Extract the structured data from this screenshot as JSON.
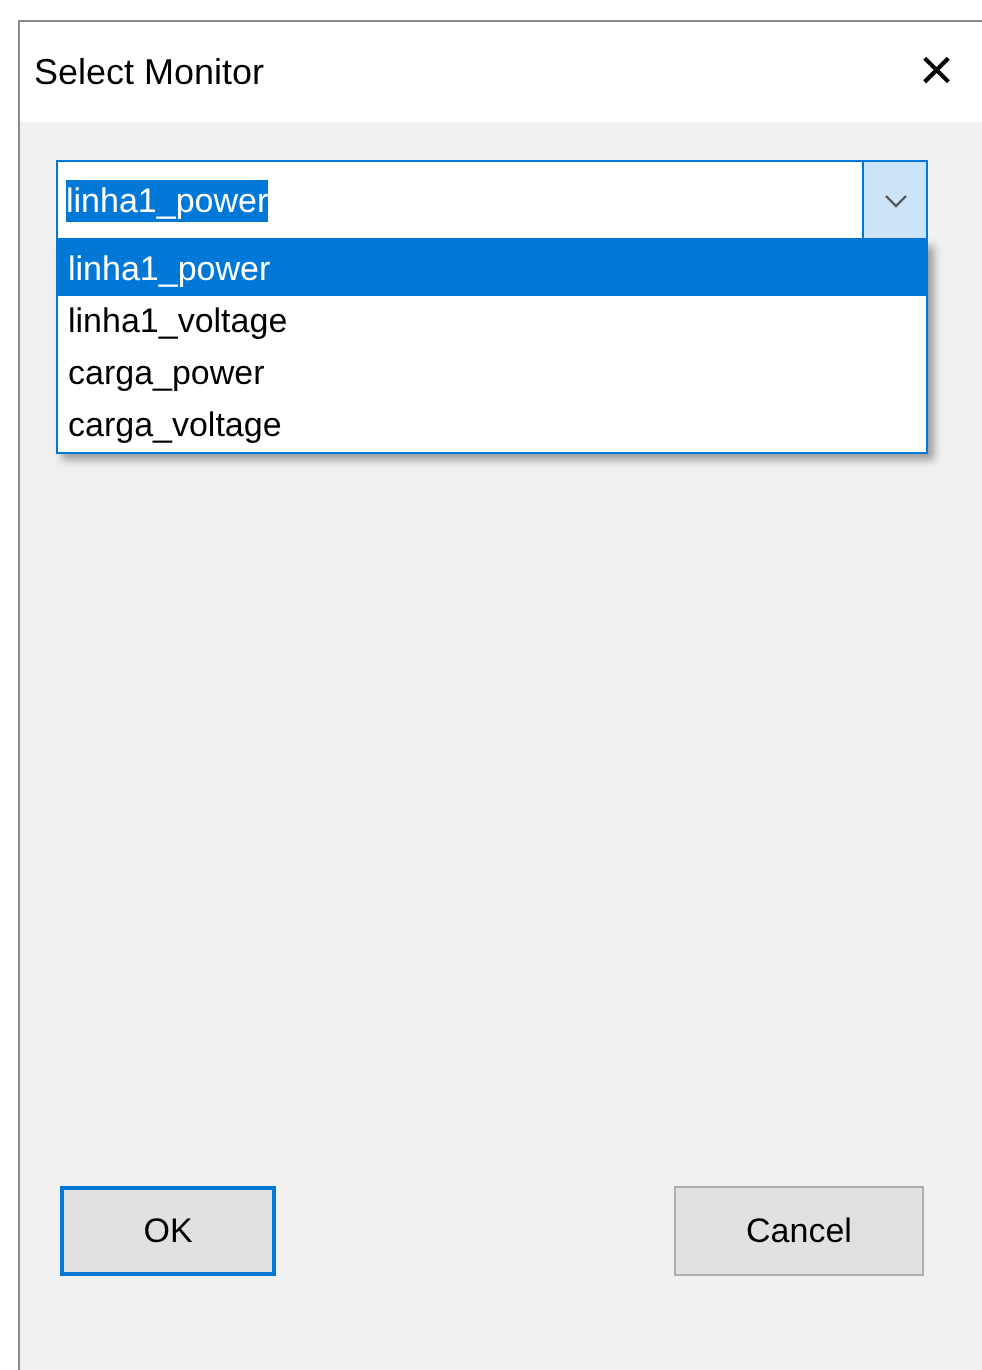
{
  "window": {
    "title": "Select Monitor",
    "close": "×"
  },
  "combo": {
    "value": "linha1_power",
    "expanded": true,
    "options": [
      {
        "label": "linha1_power",
        "selected": true
      },
      {
        "label": "linha1_voltage",
        "selected": false
      },
      {
        "label": "carga_power",
        "selected": false
      },
      {
        "label": "carga_voltage",
        "selected": false
      }
    ]
  },
  "buttons": [
    {
      "label": "OK",
      "default": true
    },
    {
      "label": "Cancel",
      "default": false
    }
  ]
}
